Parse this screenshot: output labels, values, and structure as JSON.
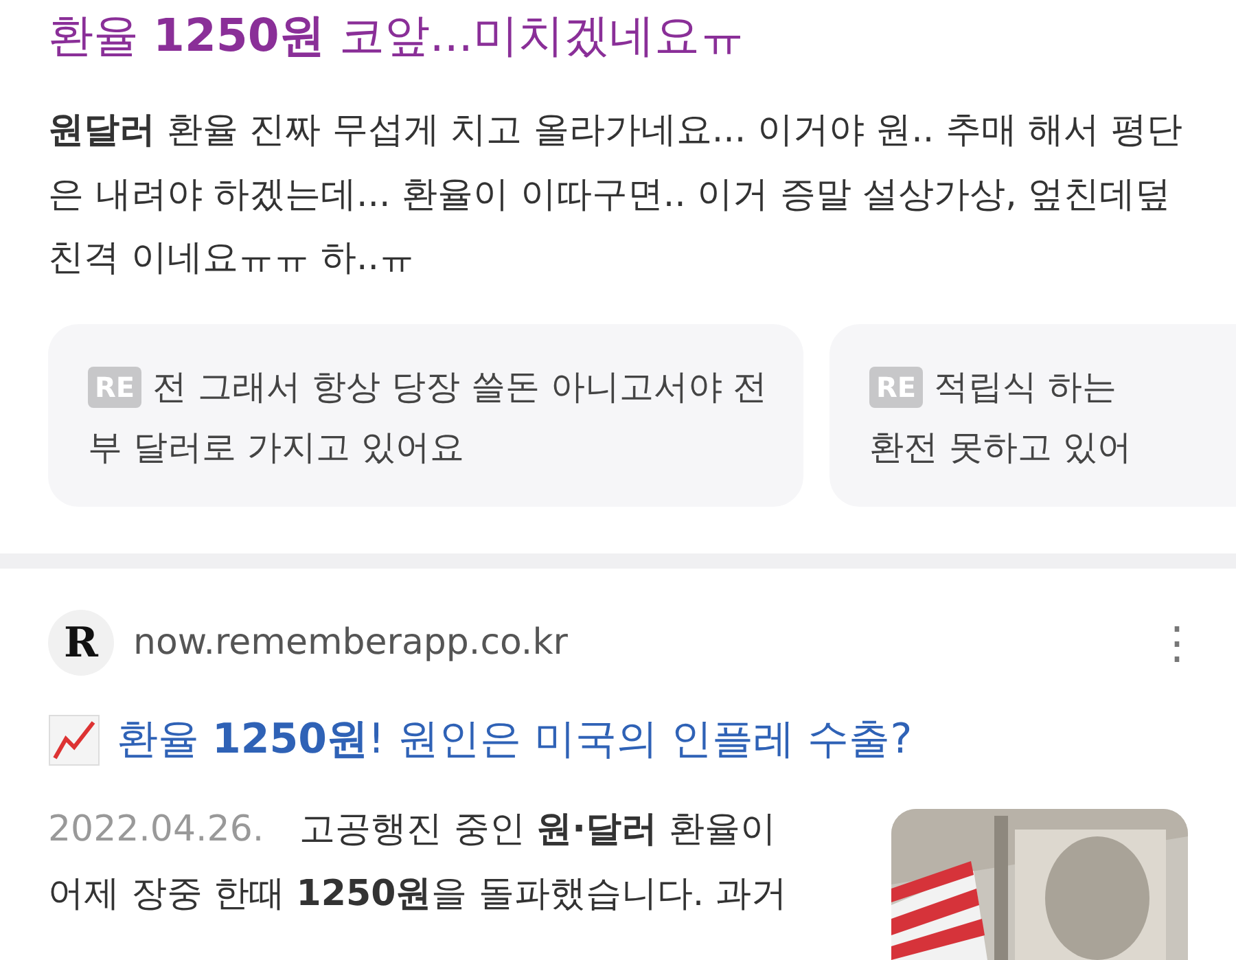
{
  "post": {
    "title": "환율 **1250원** 코앞...미치겠네요ㅠ",
    "body": "**원달러** 환율 진짜 무섭게 치고 올라가네요... 이거야 원.. 추매 해서 평단은 내려야 하겠는데... 환율이 이따구면.. 이거 증말 설상가상, 엎친데덮친격 이네요ㅠㅠ 하..ㅠ",
    "replies": [
      {
        "badge": "RE",
        "lines": [
          "전 그래서 항상 당장 쓸돈 아니고서야 전",
          "부 달러로 가지고 있어요"
        ]
      },
      {
        "badge": "RE",
        "lines": [
          "적립식 하는",
          "환전 못하고 있어"
        ]
      }
    ]
  },
  "result": {
    "favicon": "R",
    "site": "now.rememberapp.co.kr",
    "menu": "⋮",
    "title": "환율 **1250원**! 원인은 미국의 인플레 수출?",
    "date": "2022.04.26.",
    "snippet_lines": [
      "고공행진 중인 **원·달러** 환율이",
      "어제 장중 한때 **1250원**을 돌파했습니다. 과거"
    ]
  }
}
